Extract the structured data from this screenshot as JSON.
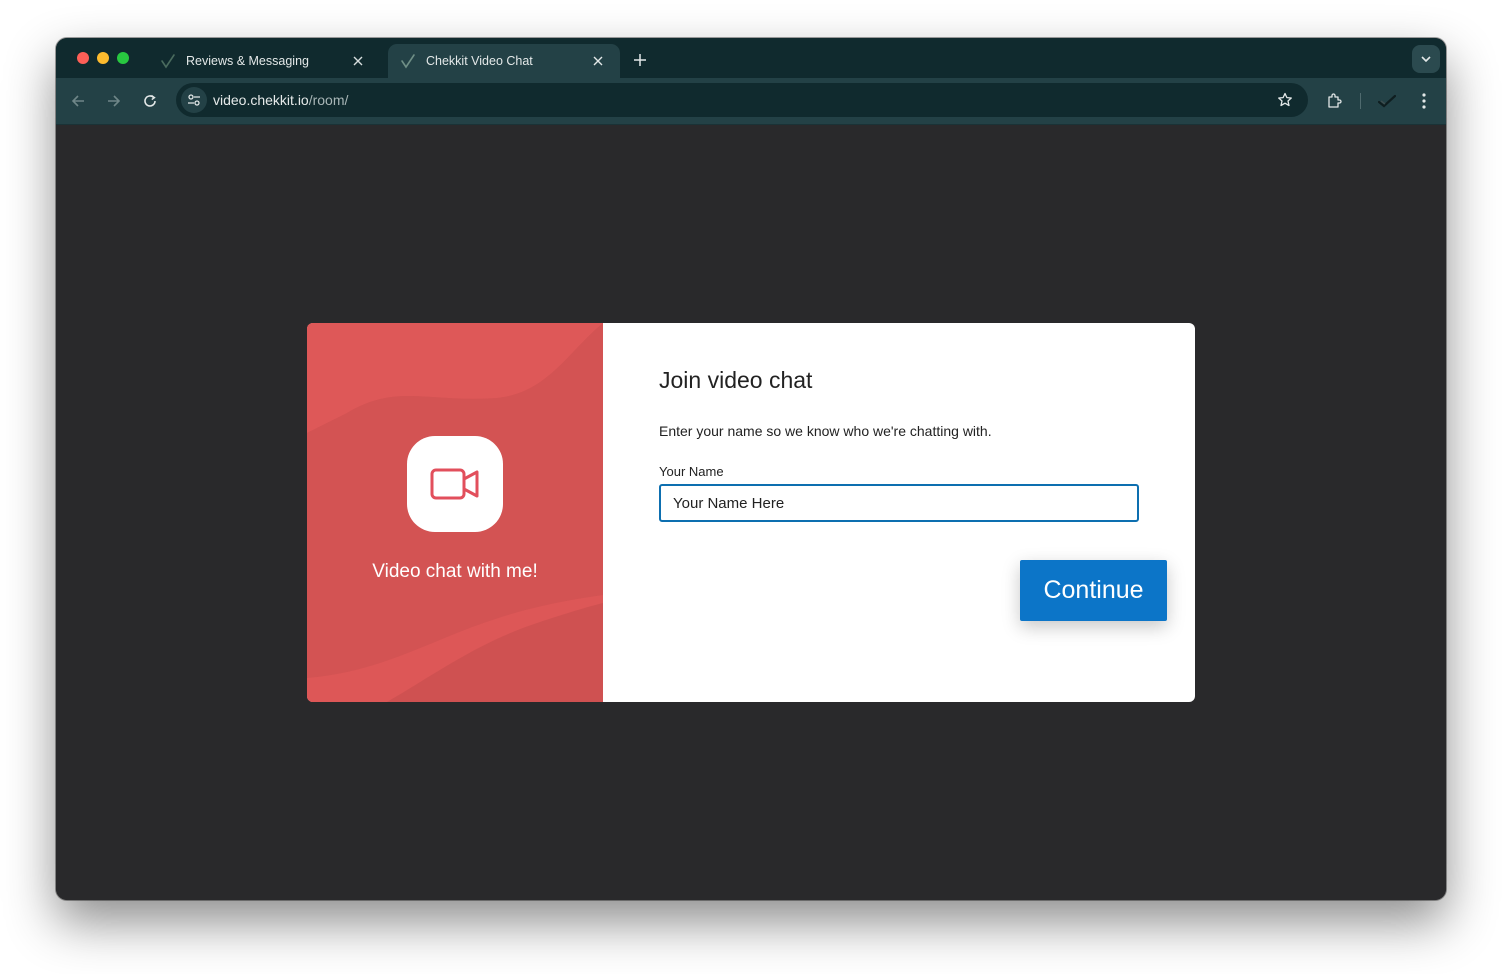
{
  "browser": {
    "tabs": [
      {
        "title": "Reviews & Messaging",
        "favicon": "checkmark-icon",
        "active": false
      },
      {
        "title": "Chekkit Video Chat",
        "favicon": "checkmark-icon",
        "active": true
      }
    ],
    "address": {
      "host": "video.chekkit.io",
      "path": "/room/"
    }
  },
  "page": {
    "left_panel": {
      "icon": "video-camera-icon",
      "caption": "Video chat with me!"
    },
    "form": {
      "heading": "Join video chat",
      "subtitle": "Enter your name so we know who we're chatting with.",
      "name_label": "Your Name",
      "name_placeholder": "Your Name Here",
      "continue_label": "Continue"
    }
  },
  "colors": {
    "accent": "#0c75c8",
    "panel": "#d65555",
    "page_background": "#29292b"
  }
}
